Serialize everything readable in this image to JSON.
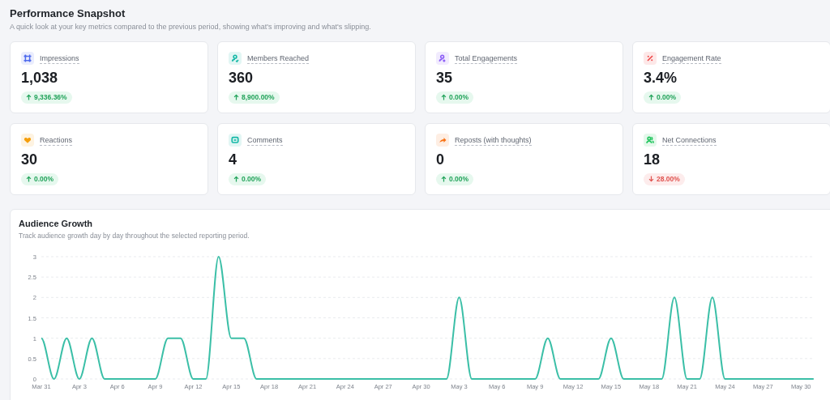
{
  "header": {
    "title": "Performance Snapshot",
    "subtitle": "A quick look at your key metrics compared to the previous period, showing what's improving and what's slipping."
  },
  "metrics": [
    {
      "label": "Impressions",
      "value": "1,038",
      "change": "9,336.36%",
      "increase": true,
      "color": "#4f6bed"
    },
    {
      "label": "Members Reached",
      "value": "360",
      "change": "8,900.00%",
      "increase": true,
      "color": "#14b8a6"
    },
    {
      "label": "Total Engagements",
      "value": "35",
      "change": "0.00%",
      "increase": true,
      "color": "#8b5cf6"
    },
    {
      "label": "Engagement Rate",
      "value": "3.4%",
      "change": "0.00%",
      "increase": true,
      "color": "#ef4444"
    },
    {
      "label": "Reactions",
      "value": "30",
      "change": "0.00%",
      "increase": true,
      "color": "#f59e0b"
    },
    {
      "label": "Comments",
      "value": "4",
      "change": "0.00%",
      "increase": true,
      "color": "#14b8a6"
    },
    {
      "label": "Reposts (with thoughts)",
      "value": "0",
      "change": "0.00%",
      "increase": true,
      "color": "#f97316"
    },
    {
      "label": "Net Connections",
      "value": "18",
      "change": "28.00%",
      "increase": false,
      "color": "#22c55e"
    }
  ],
  "audience_growth": {
    "title": "Audience Growth",
    "subtitle": "Track audience growth day by day throughout the selected reporting period.",
    "chart_data": {
      "type": "line",
      "categories": [
        "Mar 31",
        null,
        null,
        "Apr 3",
        null,
        null,
        "Apr 6",
        null,
        null,
        "Apr 9",
        null,
        null,
        "Apr 12",
        null,
        null,
        "Apr 15",
        null,
        null,
        "Apr 18",
        null,
        null,
        "Apr 21",
        null,
        null,
        "Apr 24",
        null,
        null,
        "Apr 27",
        null,
        null,
        "Apr 30",
        null,
        null,
        "May 3",
        null,
        null,
        "May 6",
        null,
        null,
        "May 9",
        null,
        null,
        "May 12",
        null,
        null,
        "May 15",
        null,
        null,
        "May 18",
        null,
        null,
        "May 21",
        null,
        null,
        "May 24",
        null,
        null,
        "May 27",
        null,
        null,
        "May 30",
        null
      ],
      "grid": true,
      "series": [
        {
          "color": "#3bbfa7",
          "values": [
            1,
            0,
            1,
            0,
            1,
            0,
            0,
            0,
            0,
            0,
            1,
            1,
            0,
            0,
            3,
            1,
            1,
            0,
            0,
            0,
            0,
            0,
            0,
            0,
            0,
            0,
            0,
            0,
            0,
            0,
            0,
            0,
            0,
            2,
            0,
            0,
            0,
            0,
            0,
            0,
            1,
            0,
            0,
            0,
            0,
            1,
            0,
            0,
            0,
            0,
            2,
            0,
            0,
            2,
            0,
            0,
            0,
            0,
            0,
            0,
            0,
            0
          ]
        }
      ],
      "ylim": [
        0,
        3
      ],
      "yticks": [
        {
          "value": 0,
          "label": "0"
        },
        {
          "value": 0.5,
          "label": "0.5"
        },
        {
          "value": 1,
          "label": "1"
        },
        {
          "value": 1.5,
          "label": "1.5"
        },
        {
          "value": 2,
          "label": "2"
        },
        {
          "value": 2.5,
          "label": "2.5"
        },
        {
          "value": 3,
          "label": "3"
        }
      ]
    }
  }
}
